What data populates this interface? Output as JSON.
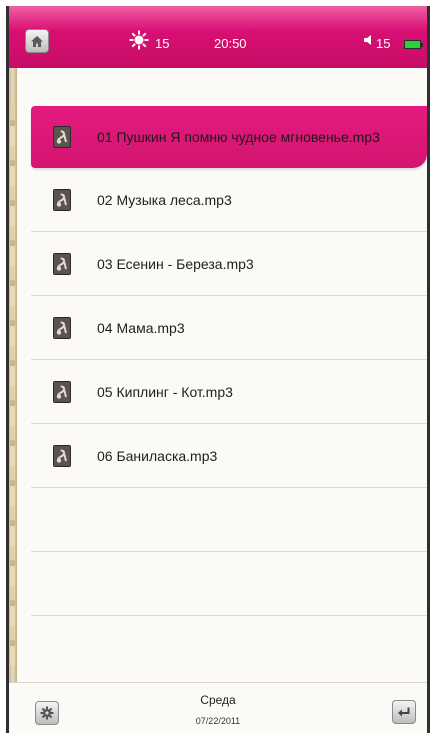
{
  "status": {
    "brightness": "15",
    "time": "20:50",
    "volume": "15"
  },
  "icons": {
    "home": "home-icon",
    "brightness": "sun-icon",
    "volume": "speaker-icon",
    "battery": "battery-icon",
    "file": "music-file-icon",
    "settings": "gear-icon",
    "back": "return-arrow-icon"
  },
  "colors": {
    "accent": "#d90f72",
    "selected_row": "#e51a7f",
    "battery": "#2bd23b"
  },
  "files": [
    {
      "name": "01 Пушкин  Я помню чудное мгновенье.mp3",
      "selected": true
    },
    {
      "name": "02 Музыка леса.mp3",
      "selected": false
    },
    {
      "name": "03 Есенин - Береза.mp3",
      "selected": false
    },
    {
      "name": "04 Мама.mp3",
      "selected": false
    },
    {
      "name": "05 Киплинг - Кот.mp3",
      "selected": false
    },
    {
      "name": "06 Баниласка.mp3",
      "selected": false
    }
  ],
  "footer": {
    "day": "Среда",
    "date": "07/22/2011"
  }
}
